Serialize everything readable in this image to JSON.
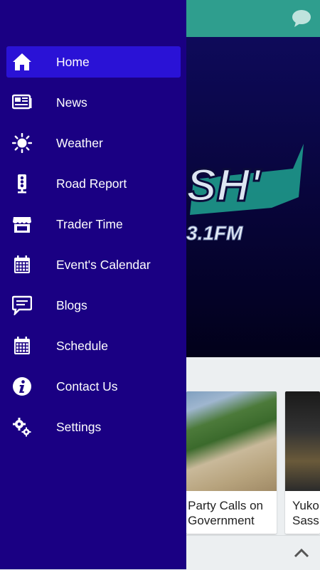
{
  "app": {
    "logo_text": "SH'",
    "logo_freq": "3.1FM",
    "cards": [
      {
        "caption_lines": [
          "n Party Calls on",
          "n Government"
        ]
      },
      {
        "caption_lines": [
          "Yuko",
          "Sass"
        ]
      }
    ]
  },
  "drawer": {
    "items": [
      {
        "label": "Home",
        "icon": "home-icon",
        "active": true
      },
      {
        "label": "News",
        "icon": "news-icon",
        "active": false
      },
      {
        "label": "Weather",
        "icon": "sun-icon",
        "active": false
      },
      {
        "label": "Road Report",
        "icon": "traffic-light-icon",
        "active": false
      },
      {
        "label": "Trader Time",
        "icon": "store-icon",
        "active": false
      },
      {
        "label": "Event's Calendar",
        "icon": "calendar-icon",
        "active": false
      },
      {
        "label": "Blogs",
        "icon": "chat-bubble-icon",
        "active": false
      },
      {
        "label": "Schedule",
        "icon": "calendar-icon",
        "active": false
      },
      {
        "label": "Contact Us",
        "icon": "info-icon",
        "active": false
      },
      {
        "label": "Settings",
        "icon": "gears-icon",
        "active": false
      }
    ]
  },
  "colors": {
    "drawer_bg": "#1a0083",
    "active_item_bg": "#2a12d6",
    "topbar": "#2f9e8e"
  }
}
